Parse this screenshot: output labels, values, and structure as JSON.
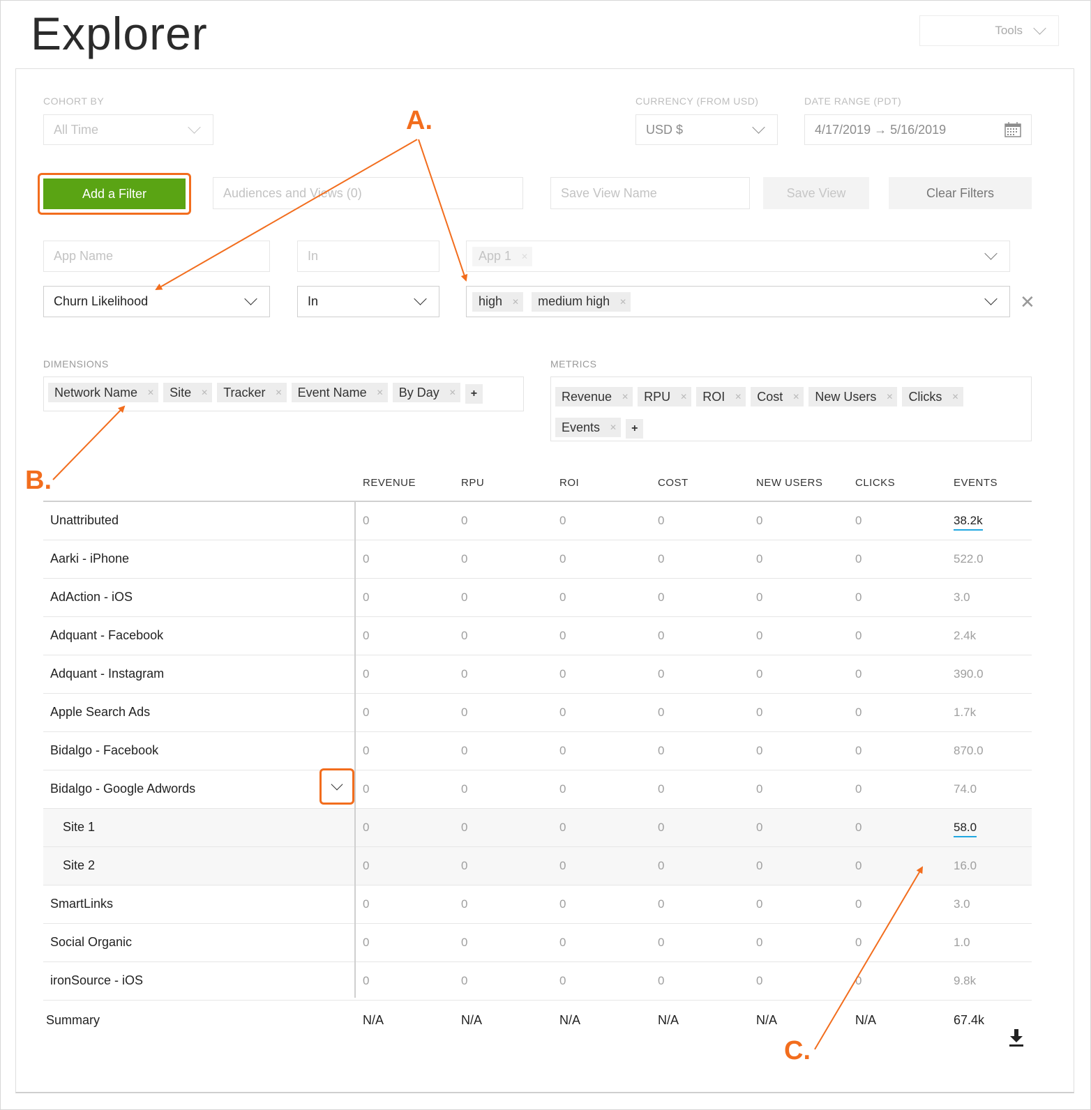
{
  "title": "Explorer",
  "tools_label": "Tools",
  "filters": {
    "cohort_label": "COHORT BY",
    "cohort_value": "All Time",
    "currency_label": "CURRENCY (FROM USD)",
    "currency_value": "USD $",
    "date_label": "DATE RANGE (PDT)",
    "date_value": "4/17/2019 → 5/16/2019"
  },
  "actions": {
    "add_filter": "Add a Filter",
    "audiences": "Audiences and Views (0)",
    "save_view_placeholder": "Save View Name",
    "save_view": "Save View",
    "clear_filters": "Clear Filters"
  },
  "filter_rows": [
    {
      "field": "App Name",
      "operator": "In",
      "values": [
        "App 1"
      ]
    },
    {
      "field": "Churn Likelihood",
      "operator": "In",
      "values": [
        "high",
        "medium high"
      ]
    }
  ],
  "dimensions": {
    "label": "DIMENSIONS",
    "items": [
      "Network Name",
      "Site",
      "Tracker",
      "Event Name",
      "By Day"
    ]
  },
  "metrics": {
    "label": "METRICS",
    "items": [
      "Revenue",
      "RPU",
      "ROI",
      "Cost",
      "New Users",
      "Clicks",
      "Events"
    ]
  },
  "table": {
    "columns": [
      "REVENUE",
      "RPU",
      "ROI",
      "COST",
      "NEW USERS",
      "CLICKS",
      "EVENTS"
    ],
    "rows": [
      {
        "name": "Unattributed",
        "values": [
          "0",
          "0",
          "0",
          "0",
          "0",
          "0",
          "38.2k"
        ],
        "link": true,
        "sub": false
      },
      {
        "name": "Aarki - iPhone",
        "values": [
          "0",
          "0",
          "0",
          "0",
          "0",
          "0",
          "522.0"
        ],
        "link": false,
        "sub": false
      },
      {
        "name": "AdAction - iOS",
        "values": [
          "0",
          "0",
          "0",
          "0",
          "0",
          "0",
          "3.0"
        ],
        "link": false,
        "sub": false
      },
      {
        "name": "Adquant - Facebook",
        "values": [
          "0",
          "0",
          "0",
          "0",
          "0",
          "0",
          "2.4k"
        ],
        "link": false,
        "sub": false
      },
      {
        "name": "Adquant - Instagram",
        "values": [
          "0",
          "0",
          "0",
          "0",
          "0",
          "0",
          "390.0"
        ],
        "link": false,
        "sub": false
      },
      {
        "name": "Apple Search Ads",
        "values": [
          "0",
          "0",
          "0",
          "0",
          "0",
          "0",
          "1.7k"
        ],
        "link": false,
        "sub": false
      },
      {
        "name": "Bidalgo - Facebook",
        "values": [
          "0",
          "0",
          "0",
          "0",
          "0",
          "0",
          "870.0"
        ],
        "link": false,
        "sub": false
      },
      {
        "name": "Bidalgo - Google Adwords",
        "values": [
          "0",
          "0",
          "0",
          "0",
          "0",
          "0",
          "74.0"
        ],
        "link": false,
        "sub": false
      },
      {
        "name": "Site 1",
        "values": [
          "0",
          "0",
          "0",
          "0",
          "0",
          "0",
          "58.0"
        ],
        "link": true,
        "sub": true
      },
      {
        "name": "Site 2",
        "values": [
          "0",
          "0",
          "0",
          "0",
          "0",
          "0",
          "16.0"
        ],
        "link": false,
        "sub": true
      },
      {
        "name": "SmartLinks",
        "values": [
          "0",
          "0",
          "0",
          "0",
          "0",
          "0",
          "3.0"
        ],
        "link": false,
        "sub": false
      },
      {
        "name": "Social Organic",
        "values": [
          "0",
          "0",
          "0",
          "0",
          "0",
          "0",
          "1.0"
        ],
        "link": false,
        "sub": false
      },
      {
        "name": "ironSource - iOS",
        "values": [
          "0",
          "0",
          "0",
          "0",
          "0",
          "0",
          "9.8k"
        ],
        "link": false,
        "sub": false
      }
    ],
    "summary": {
      "label": "Summary",
      "values": [
        "N/A",
        "N/A",
        "N/A",
        "N/A",
        "N/A",
        "N/A",
        "67.4k"
      ]
    }
  },
  "annotations": {
    "a": "A.",
    "b": "B.",
    "c": "C."
  },
  "colors": {
    "accent_green": "#5aa414",
    "annotation_orange": "#f26d1d",
    "link_underline": "#20a7e0"
  }
}
